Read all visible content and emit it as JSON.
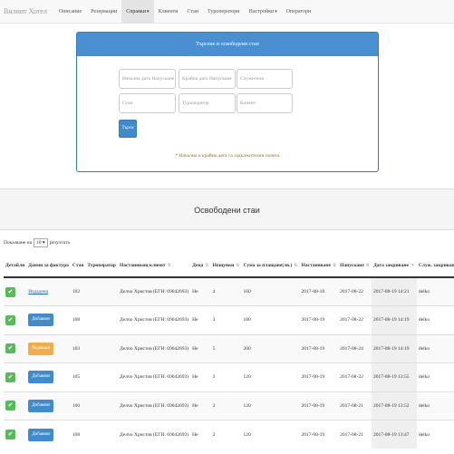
{
  "navbar": {
    "brand": "Вилиит Хотел",
    "items": [
      {
        "label": "Описание",
        "caret": false,
        "active": false
      },
      {
        "label": "Резервации",
        "caret": false,
        "active": false
      },
      {
        "label": "Справки",
        "caret": true,
        "active": true
      },
      {
        "label": "Клиенти",
        "caret": false,
        "active": false
      },
      {
        "label": "Стаи",
        "caret": false,
        "active": false
      },
      {
        "label": "Туроператори",
        "caret": false,
        "active": false
      },
      {
        "label": "Настройки",
        "caret": true,
        "active": false
      },
      {
        "label": "Оператори",
        "caret": false,
        "active": false
      }
    ]
  },
  "search": {
    "title": "Търсене и освободени стаи",
    "fields": [
      {
        "placeholder": "Начална дата Напускане"
      },
      {
        "placeholder": "Крайна дата Напускане"
      },
      {
        "placeholder": "Служители"
      },
      {
        "placeholder": "Стаи"
      },
      {
        "placeholder": "Туроператор"
      },
      {
        "placeholder": "Клиент"
      }
    ],
    "button": "Търси",
    "hint": "* Начална и крайна дата са задължителни полета"
  },
  "section_title": "Освободени стаи",
  "page_size": {
    "prefix": "Показване на",
    "value": "10",
    "suffix": "резултата"
  },
  "table": {
    "columns": [
      "Детайли",
      "Данни за фактура",
      "Стая",
      "Туроператор",
      "Настаняващ клиент",
      "Деца",
      "Нощувки",
      "Сума за плащане(лв.)",
      "Настаняване",
      "Напускане",
      "Дата закриване",
      "Служ. закриване"
    ],
    "rows": [
      {
        "invoice_type": "link",
        "invoice": "Издадена",
        "room": "102",
        "tour": "",
        "client": "Делчо Христов (ЕГН: 69042693)",
        "kids": "Не",
        "nights": "4",
        "sum": "160",
        "in": "2017-08-18",
        "out": "2017-08-22",
        "closed": "2017-08-19 14:21",
        "emp": "delko"
      },
      {
        "invoice_type": "blue",
        "invoice": "Добавяне",
        "room": "108",
        "tour": "",
        "client": "Делчо Христов (ЕГН: 69042693)",
        "kids": "Не",
        "nights": "3",
        "sum": "180",
        "in": "2017-08-19",
        "out": "2017-08-22",
        "closed": "2017-08-19 14:19",
        "emp": "delko"
      },
      {
        "invoice_type": "orange",
        "invoice": "Редакция",
        "room": "103",
        "tour": "",
        "client": "Делчо Христов (ЕГН: 69042693)",
        "kids": "Не",
        "nights": "5",
        "sum": "200",
        "in": "2017-08-19",
        "out": "2017-08-24",
        "closed": "2017-08-19 14:19",
        "emp": "delko"
      },
      {
        "invoice_type": "blue",
        "invoice": "Добавяне",
        "room": "105",
        "tour": "",
        "client": "Делчо Христов (ЕГН: 69042693)",
        "kids": "Не",
        "nights": "3",
        "sum": "120",
        "in": "2017-08-19",
        "out": "2017-08-22",
        "closed": "2017-08-19 13:55",
        "emp": "delko"
      },
      {
        "invoice_type": "blue",
        "invoice": "Добавяне",
        "room": "100",
        "tour": "",
        "client": "Делчо Христов (ЕГН: 69042693)",
        "kids": "Не",
        "nights": "2",
        "sum": "120",
        "in": "2017-08-19",
        "out": "2017-08-21",
        "closed": "2017-08-19 13:52",
        "emp": "delko"
      },
      {
        "invoice_type": "blue",
        "invoice": "Добавяне",
        "room": "108",
        "tour": "",
        "client": "Делчо Христов (ЕГН: 69042693)",
        "kids": "Не",
        "nights": "2",
        "sum": "120",
        "in": "2017-08-19",
        "out": "2017-08-21",
        "closed": "2017-08-19 13:47",
        "emp": "delko"
      }
    ]
  },
  "colors": {
    "primary": "#428bca",
    "success": "#5cb85c",
    "warning": "#f0ad4e"
  },
  "icons": {
    "check": "check-icon",
    "sort": "sort-icon"
  }
}
